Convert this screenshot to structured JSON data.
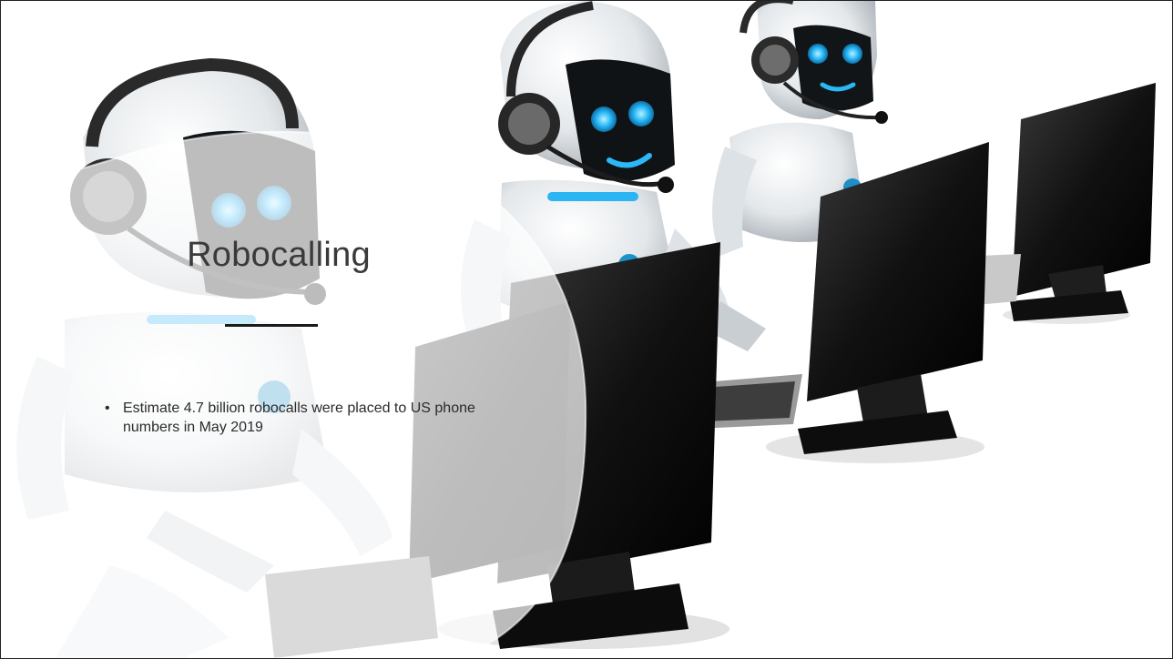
{
  "slide": {
    "title": "Robocalling",
    "bullets": [
      {
        "marker": "•",
        "text": "Estimate 4.7 billion robocalls were placed to US phone numbers in May 2019"
      }
    ]
  },
  "image": {
    "subject": "robot-call-center-illustration"
  },
  "colors": {
    "robot_body": "#e9ecef",
    "robot_face": "#111417",
    "robot_eyes": "#23b6f5",
    "monitor": "#151515",
    "overlay": "#ffffff"
  }
}
